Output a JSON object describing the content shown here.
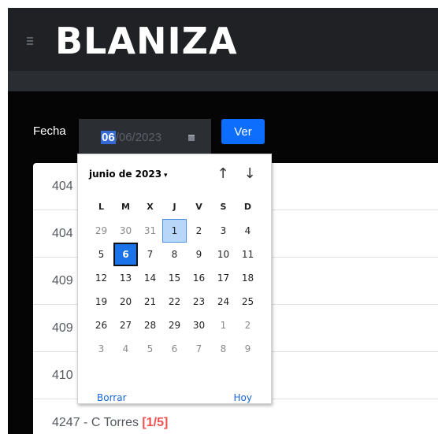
{
  "app": {
    "logo": "BLANIZA"
  },
  "form": {
    "label": "Fecha",
    "date_day": "06",
    "date_rest": "/06/2023",
    "submit_label": "Ver"
  },
  "list": {
    "rows": [
      {
        "text": "404",
        "fraction": ""
      },
      {
        "text": "404",
        "fraction": ""
      },
      {
        "text": "409",
        "fraction": ""
      },
      {
        "text": "409",
        "fraction": ""
      },
      {
        "text": "410",
        "fraction": ""
      },
      {
        "text": "4247 - C Torres ",
        "fraction": "[1/5]"
      }
    ]
  },
  "calendar": {
    "month_label": "junio de 2023",
    "caret": "▾",
    "prev_arrow": "↑",
    "next_arrow": "↓",
    "weekdays": [
      "L",
      "M",
      "X",
      "J",
      "V",
      "S",
      "D"
    ],
    "weeks": [
      [
        {
          "d": "29",
          "muted": true
        },
        {
          "d": "30",
          "muted": true
        },
        {
          "d": "31",
          "muted": true
        },
        {
          "d": "1",
          "state": "today"
        },
        {
          "d": "2"
        },
        {
          "d": "3"
        },
        {
          "d": "4"
        }
      ],
      [
        {
          "d": "5"
        },
        {
          "d": "6",
          "state": "selected"
        },
        {
          "d": "7"
        },
        {
          "d": "8"
        },
        {
          "d": "9"
        },
        {
          "d": "10"
        },
        {
          "d": "11"
        }
      ],
      [
        {
          "d": "12"
        },
        {
          "d": "13"
        },
        {
          "d": "14"
        },
        {
          "d": "15"
        },
        {
          "d": "16"
        },
        {
          "d": "17"
        },
        {
          "d": "18"
        }
      ],
      [
        {
          "d": "19"
        },
        {
          "d": "20"
        },
        {
          "d": "21"
        },
        {
          "d": "22"
        },
        {
          "d": "23"
        },
        {
          "d": "24"
        },
        {
          "d": "25"
        }
      ],
      [
        {
          "d": "26"
        },
        {
          "d": "27"
        },
        {
          "d": "28"
        },
        {
          "d": "29"
        },
        {
          "d": "30"
        },
        {
          "d": "1",
          "muted": true
        },
        {
          "d": "2",
          "muted": true
        }
      ],
      [
        {
          "d": "3",
          "muted": true
        },
        {
          "d": "4",
          "muted": true
        },
        {
          "d": "5",
          "muted": true
        },
        {
          "d": "6",
          "muted": true
        },
        {
          "d": "7",
          "muted": true
        },
        {
          "d": "8",
          "muted": true
        },
        {
          "d": "9",
          "muted": true
        }
      ]
    ],
    "clear_label": "Borrar",
    "today_label": "Hoy"
  },
  "colors": {
    "accent": "#0d6efd",
    "fraction_red": "#f14f4f",
    "header_bg": "#1f2124"
  },
  "icons": [
    "menu-icon",
    "calendar-icon",
    "arrow-up-icon",
    "arrow-down-icon",
    "caret-down-icon"
  ]
}
